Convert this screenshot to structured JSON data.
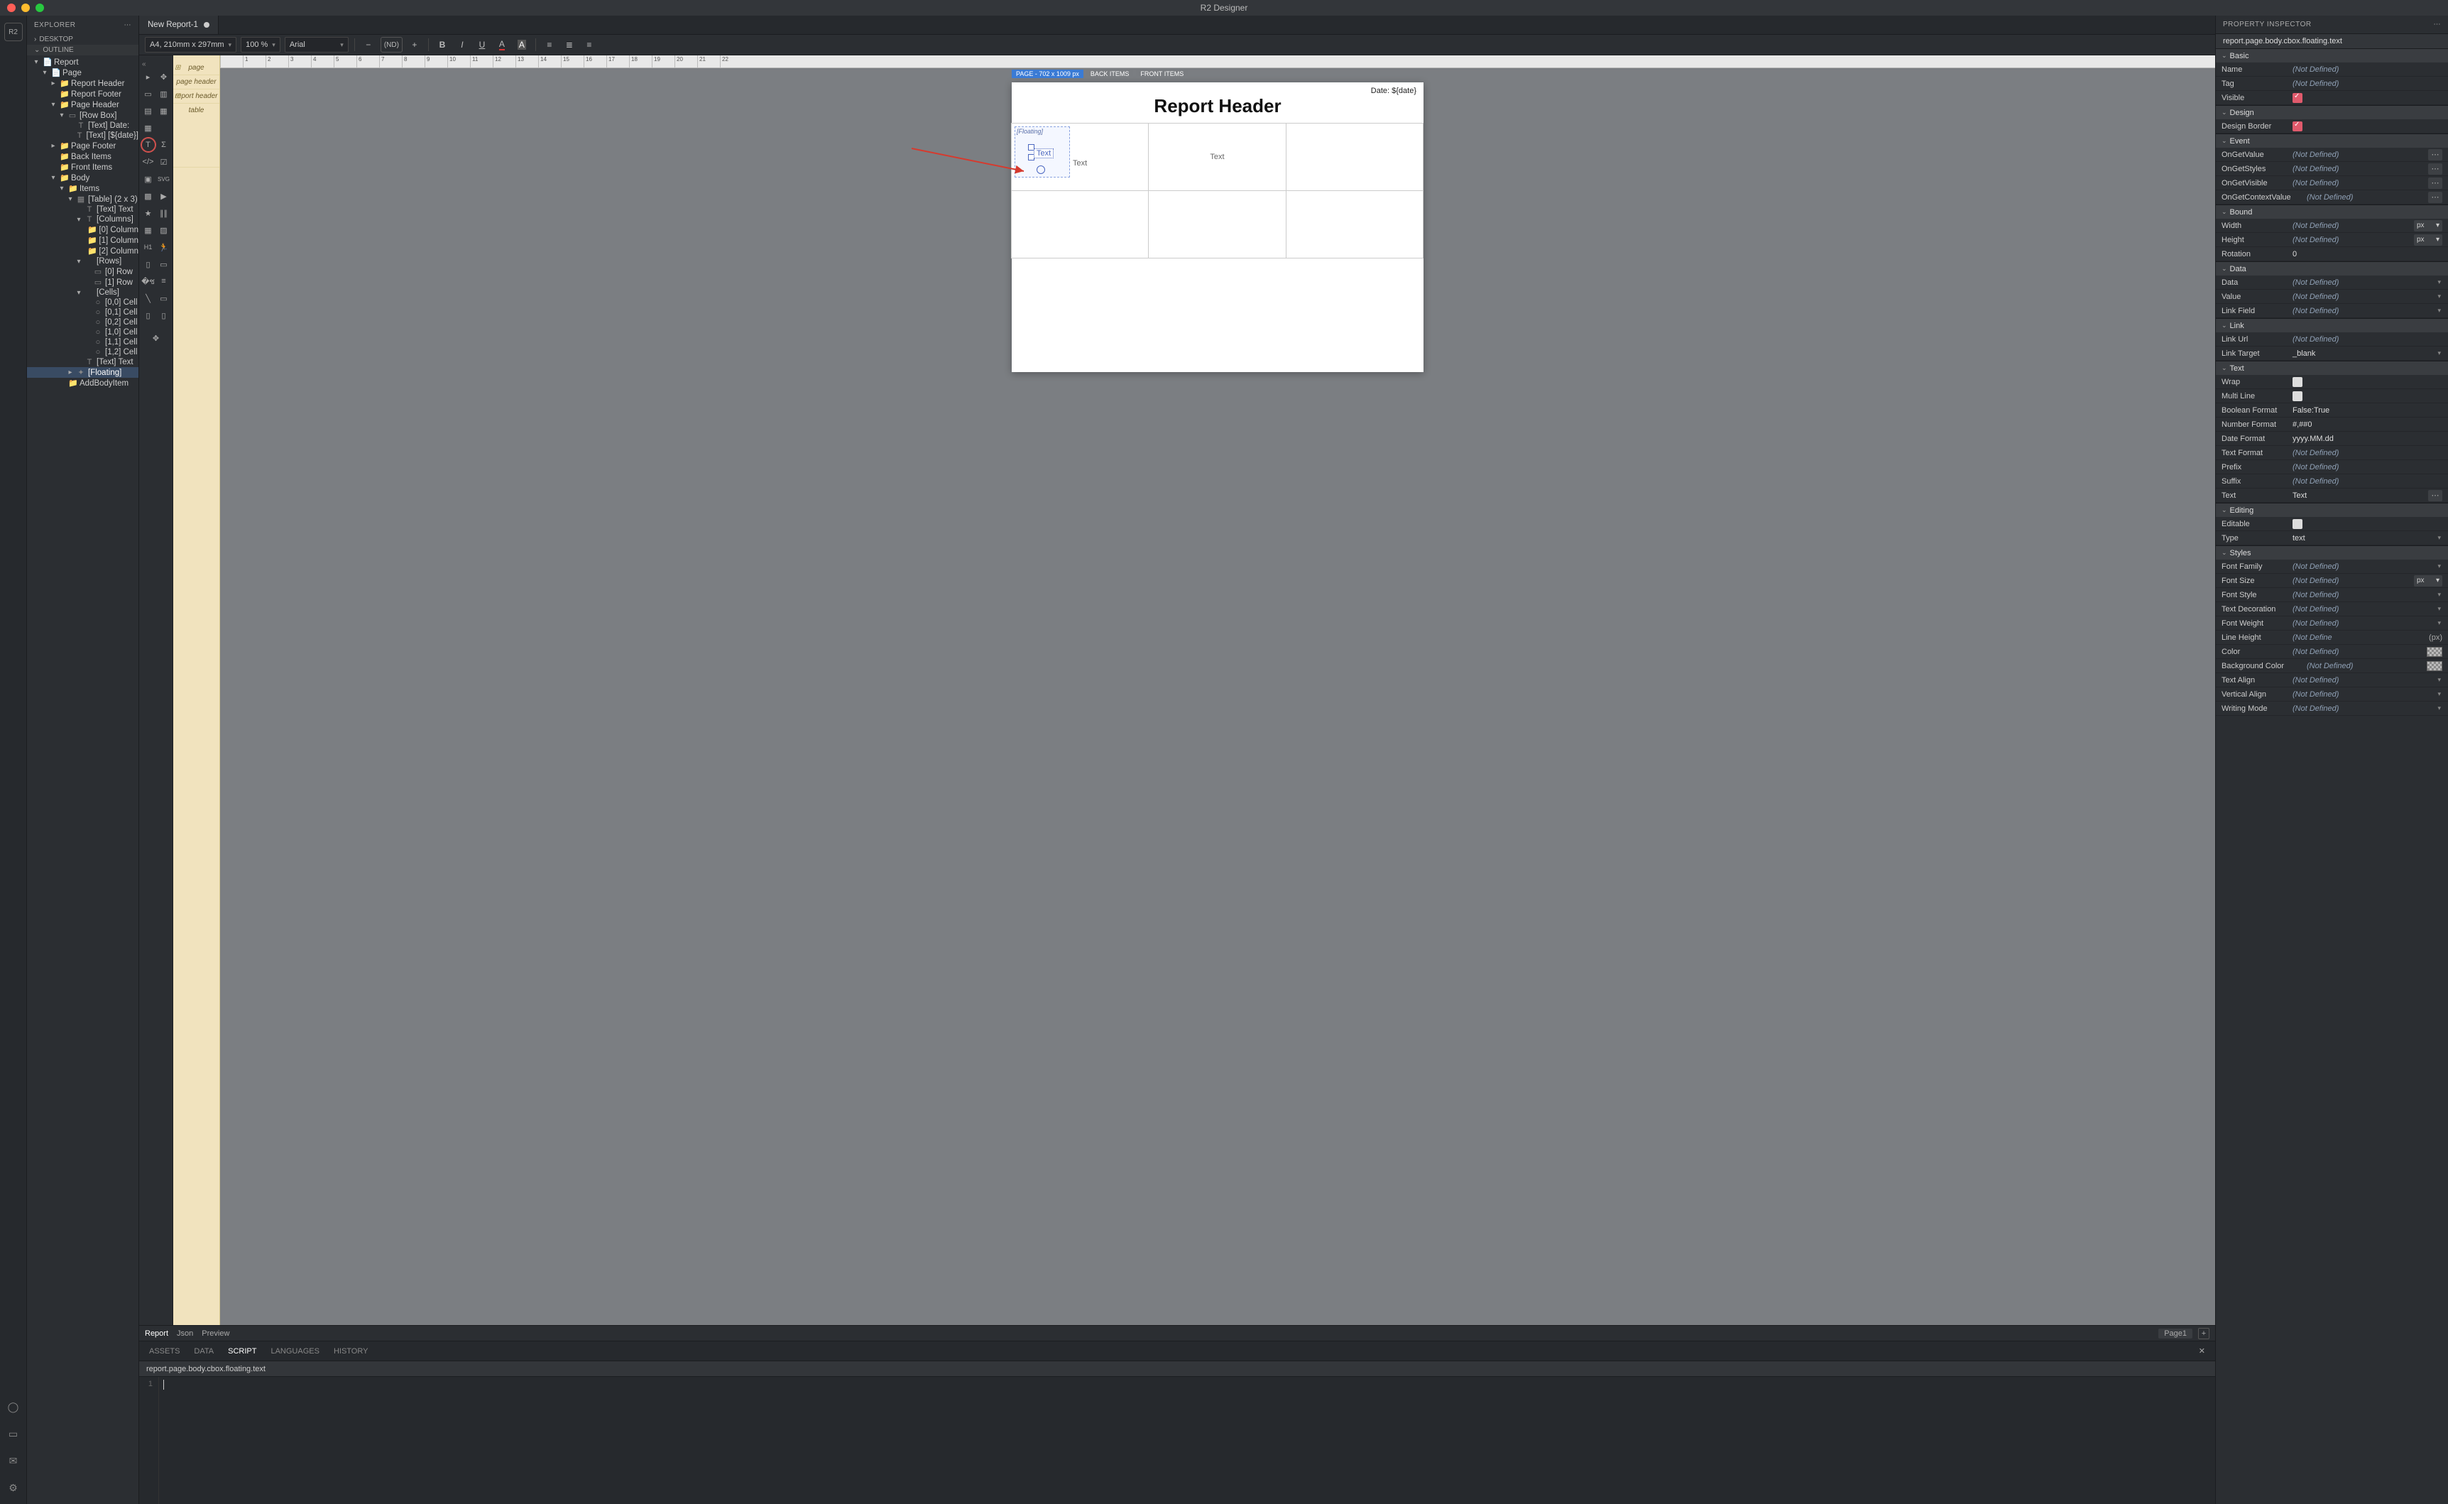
{
  "app": {
    "title": "R2 Designer"
  },
  "explorer": {
    "title": "EXPLORER",
    "desktop": "DESKTOP",
    "outline": "OUTLINE",
    "tree": [
      {
        "d": 0,
        "c": "▾",
        "i": "📄",
        "t": "Report"
      },
      {
        "d": 1,
        "c": "▾",
        "i": "📄",
        "t": "Page"
      },
      {
        "d": 2,
        "c": "▸",
        "i": "📁",
        "t": "Report Header"
      },
      {
        "d": 2,
        "c": "",
        "i": "📁",
        "t": "Report Footer"
      },
      {
        "d": 2,
        "c": "▾",
        "i": "📁",
        "t": "Page Header"
      },
      {
        "d": 3,
        "c": "▾",
        "i": "▭",
        "t": "[Row Box]"
      },
      {
        "d": 4,
        "c": "",
        "i": "T",
        "t": "[Text] Date:"
      },
      {
        "d": 4,
        "c": "",
        "i": "T",
        "t": "[Text] [${date}]"
      },
      {
        "d": 2,
        "c": "▸",
        "i": "📁",
        "t": "Page Footer"
      },
      {
        "d": 2,
        "c": "",
        "i": "📁",
        "t": "Back Items"
      },
      {
        "d": 2,
        "c": "",
        "i": "📁",
        "t": "Front Items"
      },
      {
        "d": 2,
        "c": "▾",
        "i": "📁",
        "t": "Body"
      },
      {
        "d": 3,
        "c": "▾",
        "i": "📁",
        "t": "Items"
      },
      {
        "d": 4,
        "c": "▾",
        "i": "▦",
        "t": "[Table] (2 x 3)"
      },
      {
        "d": 5,
        "c": "",
        "i": "T",
        "t": "[Text] Text"
      },
      {
        "d": 5,
        "c": "▾",
        "i": "T",
        "t": "[Columns]"
      },
      {
        "d": 6,
        "c": "",
        "i": "📁",
        "t": "[0] Column"
      },
      {
        "d": 6,
        "c": "",
        "i": "📁",
        "t": "[1] Column"
      },
      {
        "d": 6,
        "c": "",
        "i": "📁",
        "t": "[2] Column"
      },
      {
        "d": 5,
        "c": "▾",
        "i": "",
        "t": "[Rows]"
      },
      {
        "d": 6,
        "c": "",
        "i": "▭",
        "t": "[0] Row"
      },
      {
        "d": 6,
        "c": "",
        "i": "▭",
        "t": "[1] Row"
      },
      {
        "d": 5,
        "c": "▾",
        "i": "",
        "t": "[Cells]"
      },
      {
        "d": 6,
        "c": "",
        "i": "○",
        "t": "[0,0] Cell"
      },
      {
        "d": 6,
        "c": "",
        "i": "○",
        "t": "[0,1] Cell"
      },
      {
        "d": 6,
        "c": "",
        "i": "○",
        "t": "[0,2] Cell"
      },
      {
        "d": 6,
        "c": "",
        "i": "○",
        "t": "[1,0] Cell"
      },
      {
        "d": 6,
        "c": "",
        "i": "○",
        "t": "[1,1] Cell"
      },
      {
        "d": 6,
        "c": "",
        "i": "○",
        "t": "[1,2] Cell"
      },
      {
        "d": 5,
        "c": "",
        "i": "T",
        "t": "[Text] Text"
      },
      {
        "d": 4,
        "c": "▸",
        "i": "✦",
        "t": "[Floating]",
        "sel": true
      },
      {
        "d": 3,
        "c": "",
        "i": "📁",
        "t": "AddBodyItem"
      }
    ]
  },
  "tab": {
    "name": "New Report-1"
  },
  "toolbar": {
    "pagesize": "A4, 210mm x 297mm",
    "zoom": "100 %",
    "font": "Arial",
    "nd": "(ND)"
  },
  "struct": {
    "page": "page",
    "ph": "page header",
    "rh": "report header",
    "table": "table"
  },
  "canvas": {
    "pageChip": "PAGE - 702 x 1009 px",
    "backChip": "BACK ITEMS",
    "frontChip": "FRONT ITEMS",
    "date": "Date: ${date}",
    "header": "Report Header",
    "floating": "[Floating]",
    "text": "Text"
  },
  "pageTabs": {
    "report": "Report",
    "json": "Json",
    "preview": "Preview",
    "page1": "Page1"
  },
  "lower": {
    "tabs": {
      "assets": "ASSETS",
      "data": "DATA",
      "script": "SCRIPT",
      "languages": "LANGUAGES",
      "history": "HISTORY"
    },
    "path": "report.page.body.cbox.floating.text",
    "line1": "1"
  },
  "inspector": {
    "title": "PROPERTY INSPECTOR",
    "path": "report.page.body.cbox.floating.text",
    "groups": {
      "basic": "Basic",
      "design": "Design",
      "event": "Event",
      "bound": "Bound",
      "data": "Data",
      "link": "Link",
      "text": "Text",
      "editing": "Editing",
      "styles": "Styles"
    },
    "nd": "(Not Defined)",
    "labels": {
      "name": "Name",
      "tag": "Tag",
      "visible": "Visible",
      "designBorder": "Design Border",
      "onGetValue": "OnGetValue",
      "onGetStyles": "OnGetStyles",
      "onGetVisible": "OnGetVisible",
      "onGetContextValue": "OnGetContextValue",
      "width": "Width",
      "height": "Height",
      "rotation": "Rotation",
      "dataD": "Data",
      "value": "Value",
      "linkField": "Link Field",
      "linkUrl": "Link Url",
      "linkTarget": "Link Target",
      "wrap": "Wrap",
      "multiLine": "Multi Line",
      "booleanFormat": "Boolean Format",
      "numberFormat": "Number Format",
      "dateFormat": "Date Format",
      "textFormat": "Text Format",
      "prefix": "Prefix",
      "suffix": "Suffix",
      "textL": "Text",
      "editable": "Editable",
      "type": "Type",
      "fontFamily": "Font Family",
      "fontSize": "Font Size",
      "fontStyle": "Font Style",
      "textDecoration": "Text Decoration",
      "fontWeight": "Font Weight",
      "lineHeight": "Line Height",
      "color": "Color",
      "bgColor": "Background Color",
      "textAlign": "Text Align",
      "vAlign": "Vertical Align",
      "writingMode": "Writing Mode"
    },
    "vals": {
      "rotation": "0",
      "px": "px",
      "linkTarget": "_blank",
      "booleanFormat": "False:True",
      "numberFormat": "#,##0",
      "dateFormat": "yyyy.MM.dd",
      "textVal": "Text",
      "typeVal": "text",
      "ndShort": "(Not Define",
      "pxUnit": "(px)"
    }
  }
}
